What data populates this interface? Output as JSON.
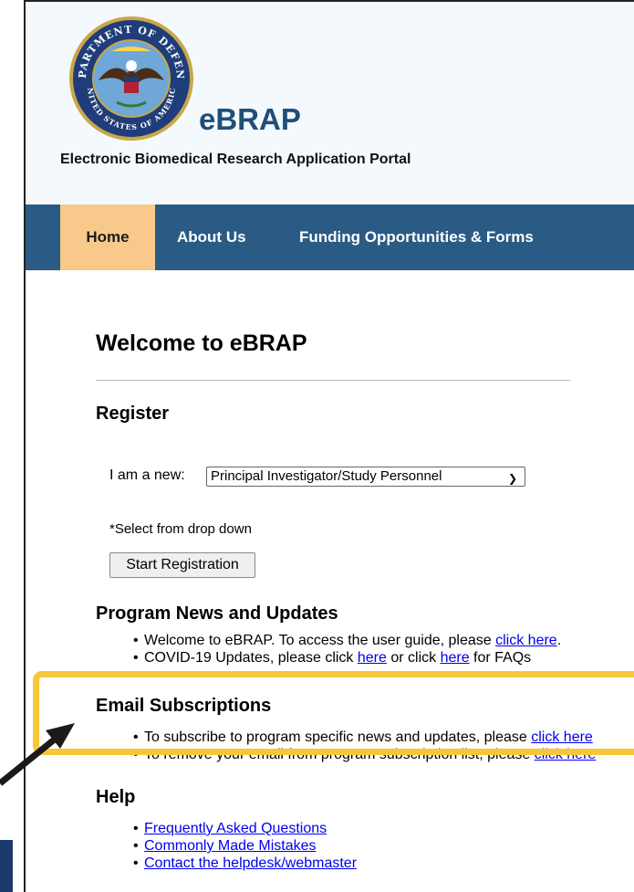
{
  "header": {
    "brand": "eBRAP",
    "subtitle": "Electronic Biomedical Research Application Portal",
    "seal_top_text": "DEPARTMENT OF DEFENSE",
    "seal_bottom_text": "UNITED STATES OF AMERICA"
  },
  "nav": {
    "home": "Home",
    "about": "About Us",
    "funding": "Funding Opportunities & Forms"
  },
  "main": {
    "welcome": "Welcome to eBRAP",
    "register": {
      "heading": "Register",
      "iam_label": "I am a new:",
      "select_value": "Principal Investigator/Study Personnel",
      "hint": "*Select from drop down",
      "button": "Start Registration"
    },
    "news": {
      "heading": "Program News and Updates",
      "item1_text": "Welcome to eBRAP. To access the user guide, please ",
      "item1_link": "click here",
      "item1_end": ".",
      "item2_text": "COVID-19 Updates, please click ",
      "item2_link1": "here",
      "item2_mid": " or click ",
      "item2_link2": "here",
      "item2_end": " for FAQs"
    },
    "email": {
      "heading": "Email Subscriptions",
      "item1_text": "To subscribe to program specific news and updates, please ",
      "item1_link": "click here",
      "item2_text": "To remove your email from program subscription list, please ",
      "item2_link": "click here"
    },
    "help": {
      "heading": "Help",
      "links": [
        "Frequently Asked Questions",
        "Commonly Made Mistakes",
        "Contact the helpdesk/webmaster"
      ]
    }
  },
  "colors": {
    "nav_bg": "#2a5b84",
    "home_tab": "#f8c98a",
    "brand": "#1f4e79",
    "highlight": "#f7c73b",
    "link": "#0000ee"
  }
}
